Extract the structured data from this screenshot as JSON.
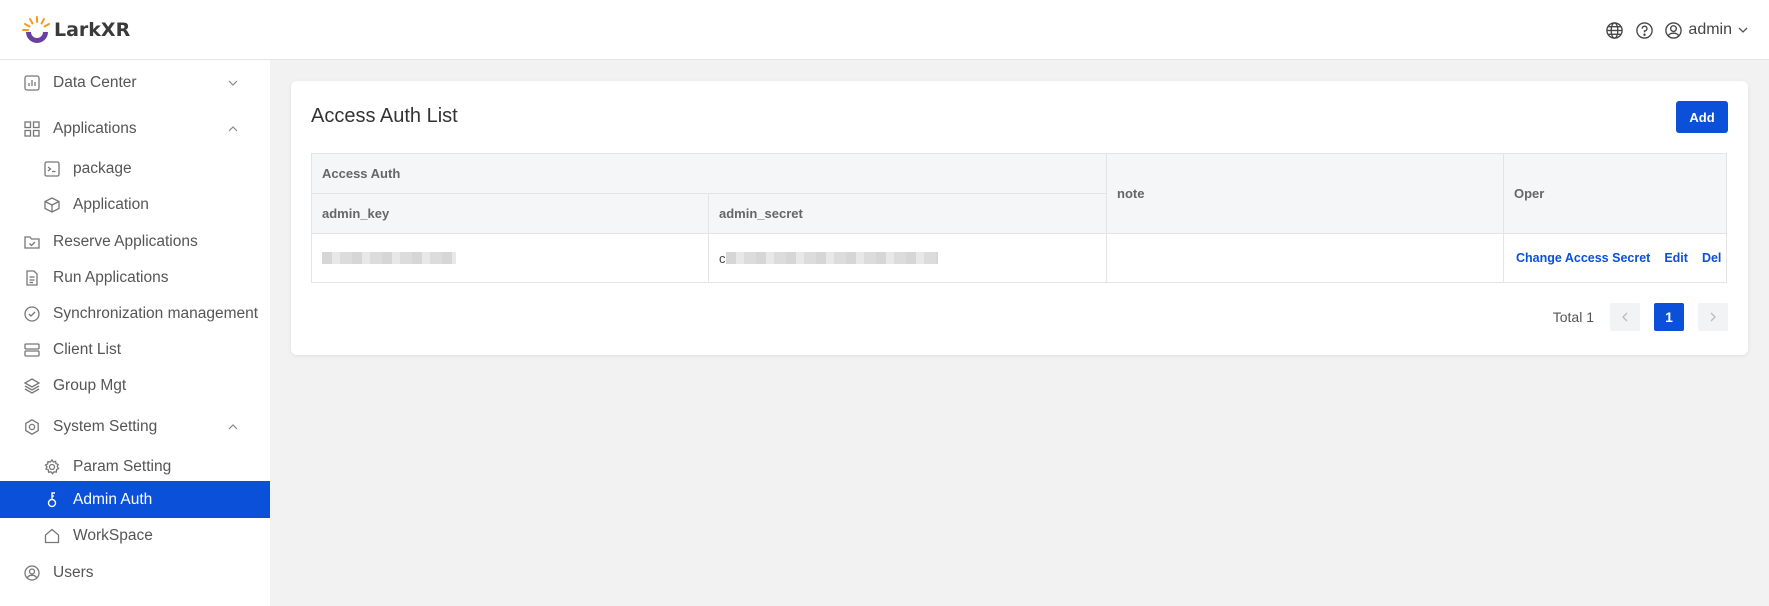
{
  "app": {
    "logo_text": "LarkXR"
  },
  "header": {
    "user_name": "admin"
  },
  "sidebar": {
    "items": [
      {
        "label": "Data Center",
        "icon": "chart-icon",
        "expanded": false
      },
      {
        "label": "Applications",
        "icon": "grid-icon",
        "expanded": true
      },
      {
        "label": "package",
        "icon": "terminal-icon"
      },
      {
        "label": "Application",
        "icon": "cube-icon"
      },
      {
        "label": "Reserve Applications",
        "icon": "calendar-icon"
      },
      {
        "label": "Run Applications",
        "icon": "document-icon"
      },
      {
        "label": "Synchronization management",
        "icon": "check-circle-icon"
      },
      {
        "label": "Client List",
        "icon": "server-icon"
      },
      {
        "label": "Group Mgt",
        "icon": "layers-icon"
      },
      {
        "label": "System Setting",
        "icon": "settings-icon",
        "expanded": true
      },
      {
        "label": "Param Setting",
        "icon": "gear-icon"
      },
      {
        "label": "Admin Auth",
        "icon": "key-icon",
        "active": true
      },
      {
        "label": "WorkSpace",
        "icon": "home-icon"
      },
      {
        "label": "Users",
        "icon": "user-icon"
      }
    ]
  },
  "main": {
    "title": "Access Auth List",
    "add_label": "Add",
    "table": {
      "group_header": "Access Auth",
      "columns": [
        "admin_key",
        "admin_secret",
        "note",
        "Oper"
      ],
      "rows": [
        {
          "admin_key": "",
          "admin_secret_prefix": "c",
          "note": ""
        }
      ],
      "actions": [
        "Change Access Secret",
        "Edit",
        "Del"
      ]
    },
    "pagination": {
      "total_label": "Total 1",
      "current_page": "1"
    }
  },
  "colors": {
    "accent": "#0a50d8",
    "background": "#f2f2f2"
  }
}
